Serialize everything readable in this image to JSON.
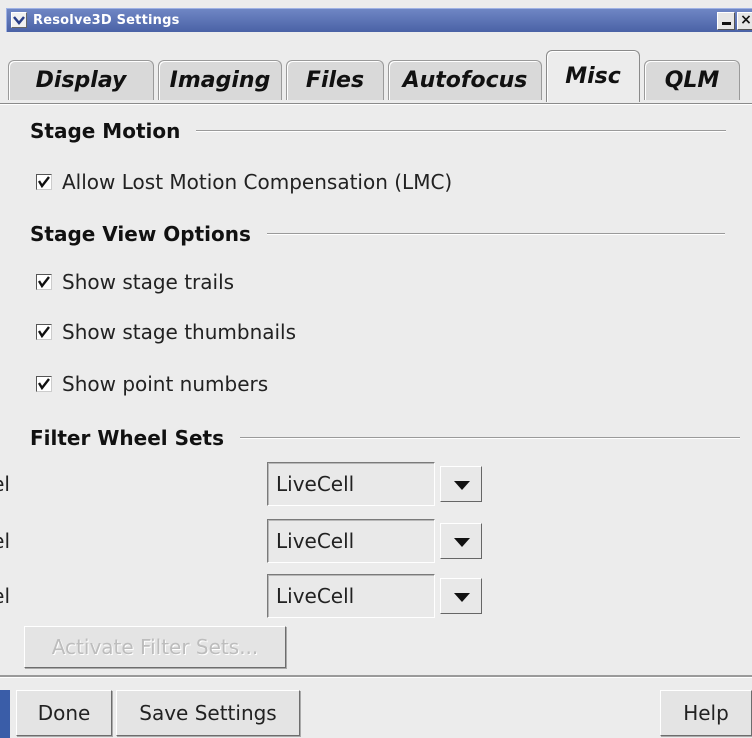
{
  "window": {
    "title": "Resolve3D Settings",
    "close_glyph": "×"
  },
  "tabs": [
    {
      "label": "Display",
      "active": false
    },
    {
      "label": "Imaging",
      "active": false
    },
    {
      "label": "Files",
      "active": false
    },
    {
      "label": "Autofocus",
      "active": false
    },
    {
      "label": "Misc",
      "active": true
    },
    {
      "label": "QLM",
      "active": false
    }
  ],
  "stage_motion": {
    "header": "Stage Motion",
    "options": [
      {
        "label": "Allow Lost Motion Compensation (LMC)",
        "checked": true
      }
    ]
  },
  "stage_view": {
    "header": "Stage View Options",
    "options": [
      {
        "label": "Show stage trails",
        "checked": true
      },
      {
        "label": "Show stage thumbnails",
        "checked": true
      },
      {
        "label": "Show point numbers",
        "checked": true
      }
    ]
  },
  "filter_wheels": {
    "header": "Filter Wheel Sets",
    "rows": [
      {
        "label": "Excitation filter wheel",
        "value": "LiveCell"
      },
      {
        "label": "Emission filter wheel",
        "value": "LiveCell"
      },
      {
        "label": "Eyepiece filter wheel",
        "value": "LiveCell"
      }
    ],
    "activate_label": "Activate Filter Sets..."
  },
  "footer": {
    "done_label": "Done",
    "save_label": "Save Settings",
    "help_label": "Help"
  },
  "colors": {
    "titlebar": "#4a62a6",
    "background": "#ececec"
  }
}
